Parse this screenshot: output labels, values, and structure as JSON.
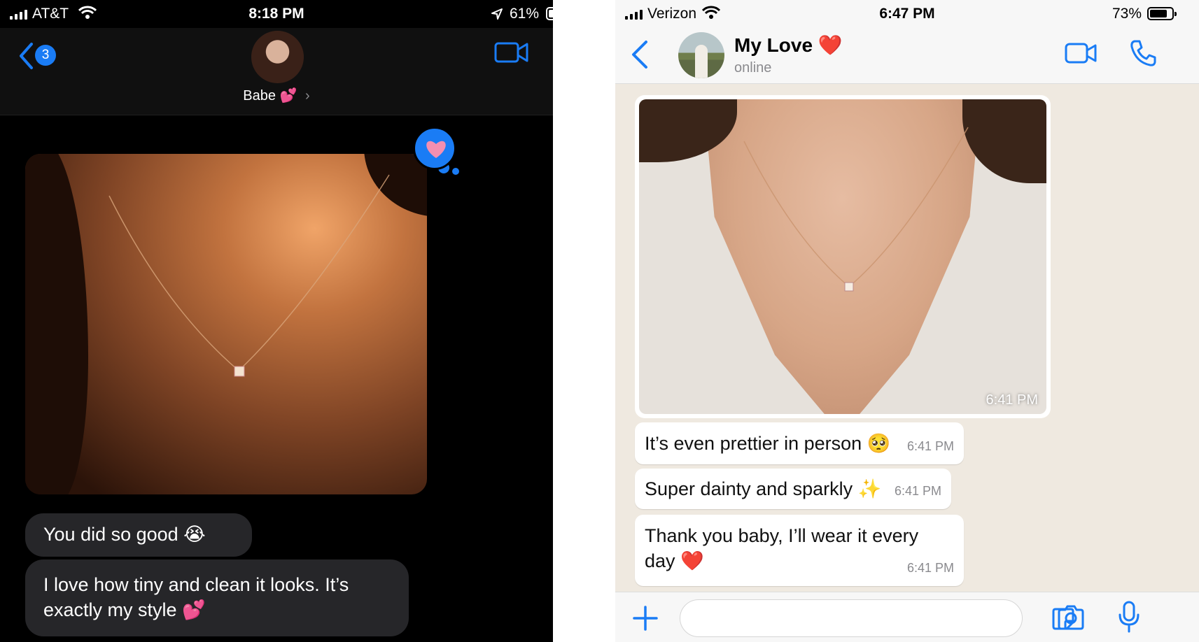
{
  "imessage": {
    "status": {
      "carrier": "AT&T",
      "time": "8:18 PM",
      "battery": "61%",
      "battery_level": 0.61
    },
    "header": {
      "back_badge": "3",
      "contact_name": "Babe 💕",
      "chevron": "›"
    },
    "tapback": "heart-icon",
    "messages": [
      {
        "text": "You did so good 😭"
      },
      {
        "text": "I love how tiny and clean it looks. It’s exactly my style 💕"
      }
    ],
    "accent": "#1a7cf5"
  },
  "whatsapp": {
    "status": {
      "carrier": "Verizon",
      "time": "6:47 PM",
      "battery": "73%",
      "battery_level": 0.73
    },
    "header": {
      "name": "My Love ❤️",
      "presence": "online"
    },
    "photo_time": "6:41 PM",
    "messages": [
      {
        "text": "It’s even prettier in person 🥺",
        "time": "6:41 PM"
      },
      {
        "text": "Super dainty and sparkly ✨",
        "time": "6:41 PM"
      },
      {
        "text": "Thank you baby, I’ll wear it every day ❤️",
        "time": "6:41 PM"
      }
    ],
    "input_placeholder": "",
    "accent": "#1a7cf5"
  }
}
